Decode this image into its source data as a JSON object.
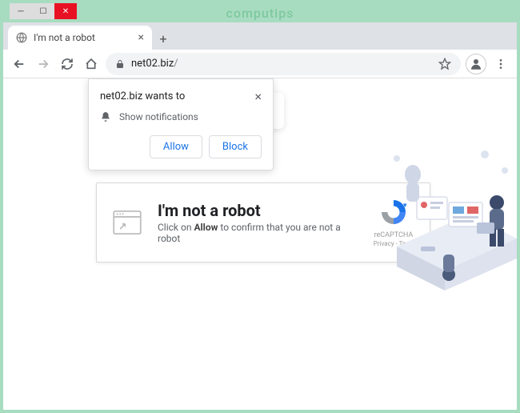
{
  "watermark": "computips",
  "tab": {
    "title": "I'm not a robot"
  },
  "url": {
    "domain": "net02.biz",
    "path": "/"
  },
  "confirm_banner": "to confirm",
  "notification": {
    "site_wants": "net02.biz wants to",
    "permission": "Show notifications",
    "allow": "Allow",
    "block": "Block"
  },
  "captcha": {
    "heading": "I'm not a robot",
    "sub_prefix": "Click on ",
    "sub_bold": "Allow",
    "sub_suffix": " to confirm that you are not a robot",
    "brand": "reCAPTCHA",
    "links": "Privacy - Term"
  }
}
